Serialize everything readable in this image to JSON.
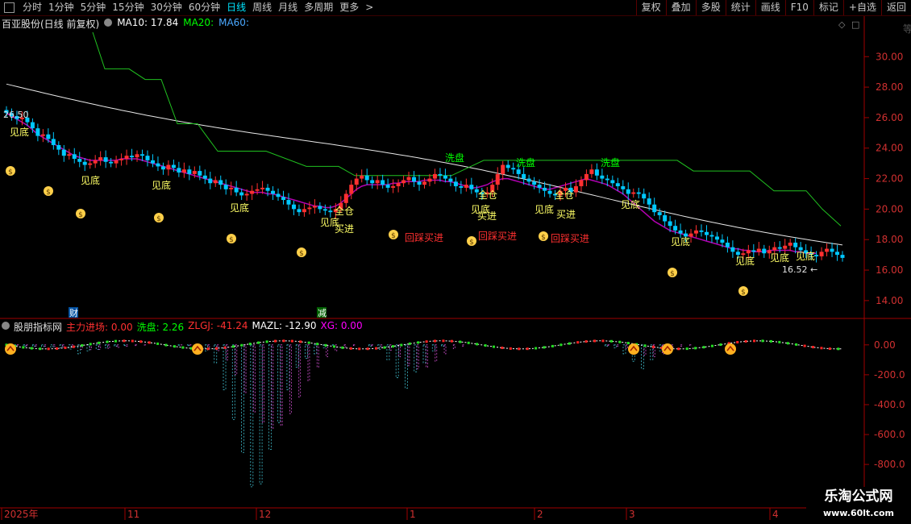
{
  "toolbar": {
    "periods": [
      "分时",
      "1分钟",
      "5分钟",
      "15分钟",
      "30分钟",
      "60分钟",
      "日线",
      "周线",
      "月线",
      "多周期",
      "更多"
    ],
    "active_period": "日线",
    "more_arrow": ">",
    "right_buttons": [
      "复权",
      "叠加",
      "多股",
      "统计",
      "画线",
      "F10",
      "标记",
      "+自选",
      "返回"
    ]
  },
  "main_chart": {
    "stock_name": "百亚股份(日线 前复权)",
    "ma10_label": "MA10: 17.84",
    "ma20_label": "MA20:",
    "ma60_label": "MA60:",
    "ma_colors": {
      "ma10": "#ffffff",
      "ma20": "#00ff00",
      "ma60": "#4aa8ff"
    },
    "high_marker": "26.50",
    "low_marker": "16.52",
    "low_arrow": "←",
    "panel_icons": [
      "◇",
      "□"
    ],
    "annotations_yellow": [
      "见底",
      "见底",
      "见底",
      "见底",
      "见底",
      "见底",
      "见底",
      "见底",
      "见底",
      "见底",
      "见底"
    ],
    "annotations_jiandi": "见底",
    "annotations_maijin": "买进",
    "annotations_quancang": "全仓",
    "annotations_xipan": "洗盘",
    "annotations_huicai": "回踩买进",
    "money_bag": "$",
    "bottom_marks": [
      "财",
      "减"
    ]
  },
  "sub_chart": {
    "name": "股朋指标网",
    "zhuli": "主力进场: 0.00",
    "xipan": "洗盘: 2.26",
    "zlgj": "ZLGJ: -41.24",
    "mazl": "MAZL: -12.90",
    "xg": "XG: 0.00",
    "colors": {
      "zhuli": "#ff3030",
      "xipan": "#00ff00",
      "zlgj": "#ff3030",
      "mazl": "#ffffff",
      "xg": "#ff00ff"
    }
  },
  "x_axis": [
    "2025年",
    "11",
    "12",
    "1",
    "2",
    "3",
    "4"
  ],
  "watermark": {
    "line1": "乐淘公式网",
    "line2": "www.60lt.com"
  },
  "right_edge_text": "等",
  "chart_data": [
    {
      "type": "candlestick",
      "title": "百亚股份(日线 前复权)",
      "y_ticks": [
        30.0,
        28.0,
        26.0,
        24.0,
        22.0,
        20.0,
        18.0,
        16.0,
        14.0
      ],
      "ylim": [
        13.2,
        31.6
      ],
      "grid": false,
      "close": [
        26.3,
        26.1,
        25.9,
        26.0,
        25.7,
        25.3,
        24.8,
        24.9,
        24.6,
        24.2,
        23.9,
        23.5,
        23.6,
        23.3,
        23.1,
        22.9,
        23.0,
        23.2,
        23.4,
        23.1,
        23.0,
        23.2,
        23.3,
        23.5,
        23.4,
        23.6,
        23.5,
        23.2,
        23.0,
        22.8,
        22.6,
        22.9,
        22.7,
        22.4,
        22.6,
        22.3,
        22.5,
        22.2,
        22.0,
        21.7,
        21.9,
        21.6,
        21.3,
        21.4,
        21.1,
        20.9,
        21.0,
        21.2,
        21.3,
        21.4,
        21.2,
        21.0,
        20.8,
        20.6,
        20.3,
        20.0,
        19.8,
        20.0,
        20.1,
        20.2,
        20.0,
        19.9,
        19.8,
        20.0,
        20.4,
        21.0,
        21.6,
        22.0,
        22.2,
        21.9,
        21.7,
        21.9,
        21.6,
        21.4,
        21.5,
        21.7,
        21.9,
        22.1,
        21.8,
        21.6,
        21.8,
        22.0,
        22.3,
        22.2,
        22.0,
        21.8,
        21.5,
        21.4,
        21.6,
        21.3,
        21.1,
        21.0,
        21.1,
        21.6,
        22.3,
        22.9,
        22.7,
        22.6,
        22.3,
        22.0,
        21.8,
        21.6,
        21.4,
        21.2,
        21.0,
        20.9,
        21.2,
        21.4,
        21.1,
        21.5,
        21.9,
        22.3,
        22.6,
        22.2,
        22.0,
        21.9,
        21.7,
        21.5,
        21.3,
        21.0,
        21.1,
        21.0,
        20.7,
        20.3,
        19.8,
        19.6,
        19.2,
        18.9,
        18.6,
        18.4,
        18.2,
        18.4,
        18.6,
        18.5,
        18.3,
        18.2,
        18.0,
        17.8,
        17.5,
        17.2,
        17.0,
        17.1,
        17.3,
        17.2,
        17.4,
        17.1,
        17.3,
        17.5,
        17.4,
        17.6,
        17.8,
        17.5,
        17.3,
        17.1,
        17.0,
        16.9,
        17.2,
        17.4,
        17.2,
        17.0,
        16.8
      ],
      "ma10": [
        26.3,
        26.1,
        25.9,
        25.7,
        25.5,
        25.2,
        24.9,
        24.7,
        24.5,
        24.3,
        24.1,
        23.9,
        23.7,
        23.5,
        23.4,
        23.3,
        23.2,
        23.2,
        23.2,
        23.2,
        23.2,
        23.2,
        23.3,
        23.3,
        23.3,
        23.3,
        23.2,
        23.1,
        23.0,
        22.9,
        22.8,
        22.7,
        22.6,
        22.5,
        22.4,
        22.3,
        22.2,
        22.1,
        22.0,
        21.9,
        21.8,
        21.7,
        21.6,
        21.5,
        21.4,
        21.3,
        21.2,
        21.1,
        21.1,
        21.1,
        21.0,
        21.0,
        20.9,
        20.8,
        20.7,
        20.6,
        20.5,
        20.4,
        20.3,
        20.2,
        20.2,
        20.1,
        20.1,
        20.2,
        20.4,
        20.7,
        21.0,
        21.3,
        21.5,
        21.6,
        21.6,
        21.6,
        21.6,
        21.6,
        21.7,
        21.7,
        21.8,
        21.8,
        21.8,
        21.8,
        21.9,
        21.9,
        21.9,
        21.9,
        21.8,
        21.8,
        21.7,
        21.6,
        21.5,
        21.4,
        21.4,
        21.5,
        21.6,
        21.8,
        21.9,
        22.0,
        22.0,
        21.9,
        21.8,
        21.7,
        21.6,
        21.5,
        21.4,
        21.3,
        21.3,
        21.4,
        21.5,
        21.6,
        21.7,
        21.8,
        21.9,
        22.0,
        21.9,
        21.8,
        21.7,
        21.6,
        21.4,
        21.2,
        21.0,
        20.7,
        20.4,
        20.1,
        19.8,
        19.5,
        19.2,
        19.0,
        18.8,
        18.6,
        18.5,
        18.4,
        18.3,
        18.2,
        18.1,
        18.0,
        17.9,
        17.8,
        17.7,
        17.6,
        17.5,
        17.4,
        17.4,
        17.3,
        17.3,
        17.2,
        17.2,
        17.2,
        17.3,
        17.3,
        17.3,
        17.3,
        17.3,
        17.2,
        17.2,
        17.1,
        17.1,
        17.1
      ]
    },
    {
      "type": "bar",
      "title": "股朋指标网",
      "y_ticks": [
        0.0,
        -200.0,
        -400.0,
        -600.0,
        -800.0
      ],
      "ylim": [
        -1080,
        150
      ],
      "series": [
        {
          "name": "ZLGJ",
          "values": [
            0,
            -5,
            -8,
            -10,
            -12,
            -15,
            -20,
            -28,
            -60,
            -40,
            -30,
            -20,
            -10,
            -5,
            0,
            0,
            0,
            0,
            0,
            -2,
            -5,
            -10,
            -40,
            -120,
            -300,
            -500,
            -720,
            -950,
            -930,
            -700,
            -520,
            -300,
            -150,
            -90,
            -60,
            -20,
            -8,
            0,
            0,
            0,
            -10,
            -30,
            -100,
            -220,
            -290,
            -180,
            -120,
            -40,
            -10,
            0,
            0,
            0,
            0,
            0,
            0,
            0,
            0,
            0,
            0,
            0,
            0,
            0,
            0,
            0,
            0,
            0,
            -10,
            -20,
            -60,
            -110,
            -160,
            -100,
            -40,
            -10,
            0,
            0,
            0,
            0,
            0,
            0,
            0,
            0,
            0,
            0,
            0,
            0,
            0,
            0,
            0,
            0,
            0,
            0,
            0
          ]
        },
        {
          "name": "MAZL",
          "values": [
            0,
            -3,
            -6,
            -8,
            -10,
            -12,
            -15,
            -20,
            -30,
            -32,
            -30,
            -25,
            -18,
            -10,
            -5,
            -2,
            0,
            0,
            0,
            -1,
            -3,
            -6,
            -15,
            -40,
            -100,
            -200,
            -320,
            -450,
            -520,
            -560,
            -540,
            -460,
            -350,
            -240,
            -150,
            -80,
            -40,
            -15,
            -5,
            0,
            -5,
            -12,
            -35,
            -80,
            -140,
            -160,
            -150,
            -110,
            -60,
            -25,
            -8,
            0,
            0,
            0,
            0,
            0,
            0,
            0,
            0,
            0,
            0,
            0,
            0,
            0,
            0,
            0,
            -5,
            -10,
            -25,
            -45,
            -70,
            -80,
            -60,
            -30,
            -10,
            -3,
            0,
            0,
            0,
            0,
            0,
            0,
            0,
            0,
            0,
            0,
            0,
            0,
            0,
            0,
            0,
            0,
            0
          ]
        }
      ]
    }
  ]
}
